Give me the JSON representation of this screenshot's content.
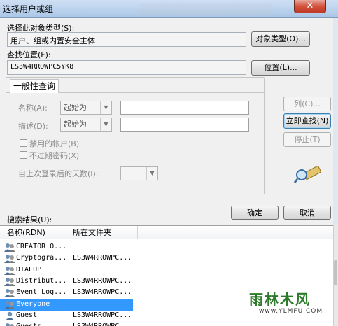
{
  "window": {
    "title": "选择用户或组",
    "close_glyph": "✕"
  },
  "object_type": {
    "label": "选择此对象类型(S):",
    "value": "用户、组或内置安全主体",
    "button": "对象类型(O)..."
  },
  "location": {
    "label": "查找位置(F):",
    "value": "LS3W4RROWPC5YK8",
    "button": "位置(L)..."
  },
  "common_query": {
    "tab": "一般性查询",
    "name_label": "名称(A):",
    "name_mode": "起始为",
    "desc_label": "描述(D):",
    "desc_mode": "起始为",
    "disabled_accounts": "禁用的帐户(B)",
    "non_expiring_pw": "不过期密码(X)",
    "days_since_logon": "自上次登录后的天数(I):"
  },
  "side_buttons": {
    "columns": "列(C)...",
    "find_now": "立即查找(N)",
    "stop": "停止(T)"
  },
  "actions": {
    "ok": "确定",
    "cancel": "取消"
  },
  "results": {
    "label": "搜索结果(U):",
    "columns": [
      "名称(RDN)",
      "所在文件夹"
    ],
    "rows": [
      {
        "name": "CREATOR O...",
        "folder": "",
        "icon": "group-icon"
      },
      {
        "name": "Cryptogra...",
        "folder": "LS3W4RROWPC...",
        "icon": "group-icon"
      },
      {
        "name": "DIALUP",
        "folder": "",
        "icon": "group-icon"
      },
      {
        "name": "Distribut...",
        "folder": "LS3W4RROWPC...",
        "icon": "group-icon"
      },
      {
        "name": "Event Log...",
        "folder": "LS3W4RROWPC...",
        "icon": "group-icon"
      },
      {
        "name": "Everyone",
        "folder": "",
        "icon": "group-icon",
        "selected": true
      },
      {
        "name": "Guest",
        "folder": "LS3W4RROWPC...",
        "icon": "user-icon"
      },
      {
        "name": "Guests",
        "folder": "LS3W4RROWPC...",
        "icon": "group-icon"
      }
    ]
  },
  "watermark": {
    "text": "雨林木风",
    "url": "www.YLMFU.COM"
  },
  "colors": {
    "selection": "#3399ff",
    "dialog_bg": "#f0f0f0",
    "titlebar": "#b9d1ec"
  }
}
